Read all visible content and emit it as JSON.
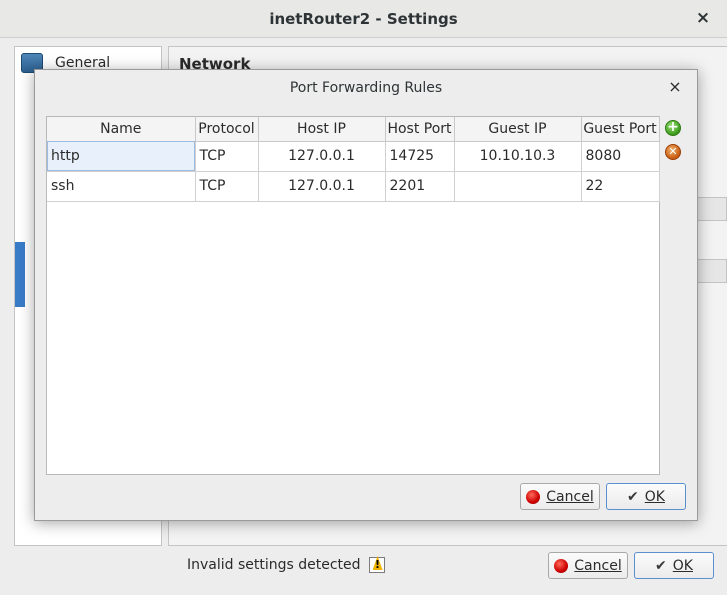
{
  "window": {
    "title": "inetRouter2 - Settings",
    "close_glyph": "×"
  },
  "sidebar": {
    "items": [
      {
        "label": "General",
        "icon": "monitor-icon"
      }
    ]
  },
  "section": {
    "title": "Network"
  },
  "status": {
    "text": "Invalid settings detected",
    "icon": "warning-icon"
  },
  "footer": {
    "cancel_label": "Cancel",
    "ok_label": "OK"
  },
  "dialog": {
    "title": "Port Forwarding Rules",
    "close_glyph": "×",
    "columns": [
      "Name",
      "Protocol",
      "Host IP",
      "Host Port",
      "Guest IP",
      "Guest Port"
    ],
    "rows": [
      {
        "name": "http",
        "protocol": "TCP",
        "host_ip": "127.0.0.1",
        "host_port": "14725",
        "guest_ip": "10.10.10.3",
        "guest_port": "8080"
      },
      {
        "name": "ssh",
        "protocol": "TCP",
        "host_ip": "127.0.0.1",
        "host_port": "2201",
        "guest_ip": "",
        "guest_port": "22"
      }
    ],
    "tools": {
      "add_icon": "add-rule-icon",
      "remove_icon": "remove-rule-icon"
    },
    "cancel_label": "Cancel",
    "ok_label": "OK"
  },
  "colors": {
    "accent": "#3a7bc8",
    "cancel_red": "#cc0000",
    "add_green": "#3a9a1a",
    "remove_orange": "#c75a10"
  }
}
